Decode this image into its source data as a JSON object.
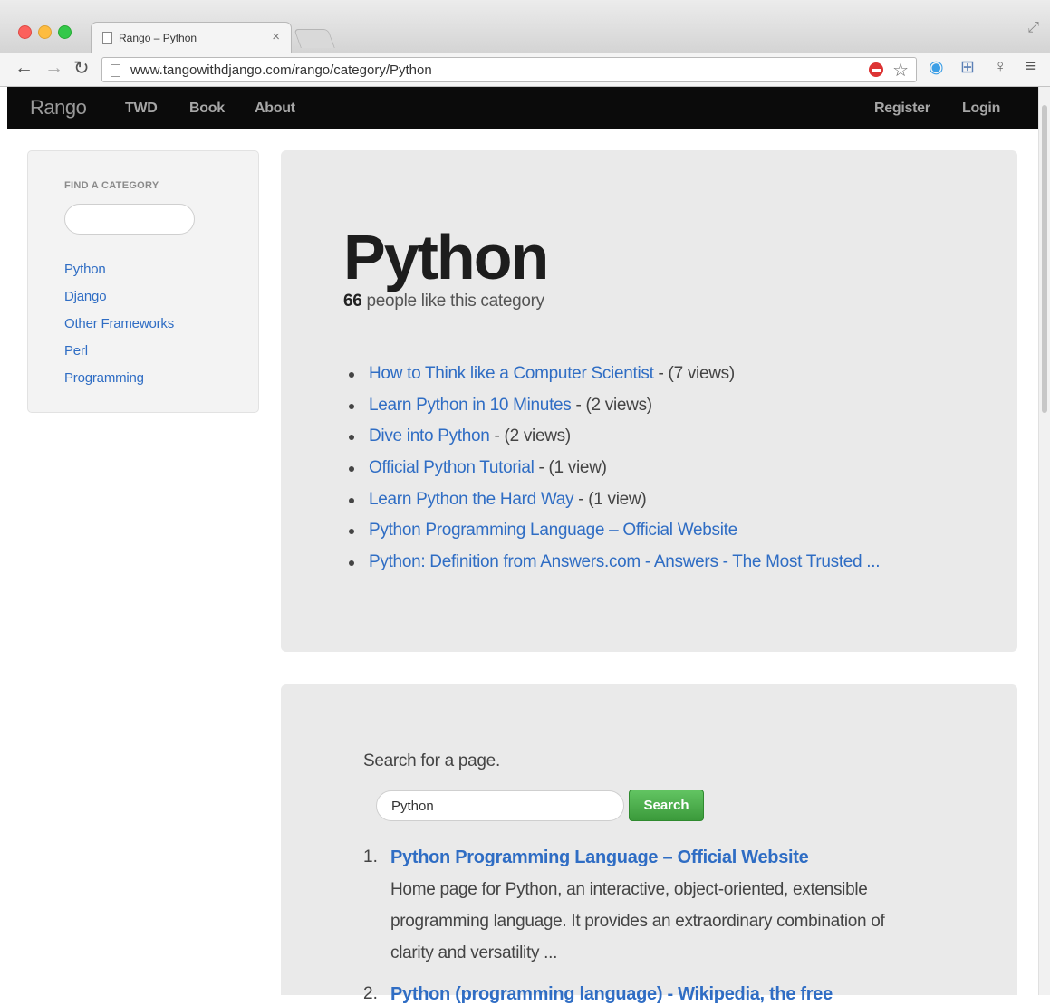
{
  "browser": {
    "tab_title": "Rango – Python",
    "tab_close": "×",
    "url": "www.tangowithdjango.com/rango/category/Python"
  },
  "site": {
    "brand": "Rango",
    "nav": [
      "TWD",
      "Book",
      "About"
    ],
    "nav_right": [
      "Register",
      "Login"
    ]
  },
  "sidebar": {
    "label": "FIND A CATEGORY",
    "categories": [
      "Python",
      "Django",
      "Other Frameworks",
      "Perl",
      "Programming"
    ]
  },
  "category": {
    "name": "Python",
    "likes_count": "66",
    "likes_text": " people like this category",
    "pages": [
      {
        "title": "How to Think like a Computer Scientist",
        "views": " - (7 views)"
      },
      {
        "title": "Learn Python in 10 Minutes",
        "views": " - (2 views)"
      },
      {
        "title": "Dive into Python",
        "views": " - (2 views)"
      },
      {
        "title": "Official Python Tutorial",
        "views": " - (1 view)"
      },
      {
        "title": "Learn Python the Hard Way",
        "views": " - (1 view)"
      },
      {
        "title": "Python Programming Language – Official Website",
        "views": ""
      },
      {
        "title": "Python: Definition from Answers.com - Answers - The Most Trusted ...",
        "views": ""
      }
    ]
  },
  "search": {
    "prompt": "Search for a page.",
    "query": "Python",
    "button": "Search",
    "results": [
      {
        "num": "1.",
        "title": "Python Programming Language – Official Website",
        "lines": [
          "Home page for Python, an interactive, object-oriented, extensible",
          "programming language. It provides an extraordinary combination of",
          "clarity and versatility ..."
        ]
      },
      {
        "num": "2.",
        "title": "Python (programming language) - Wikipedia, the free",
        "lines": []
      }
    ]
  }
}
